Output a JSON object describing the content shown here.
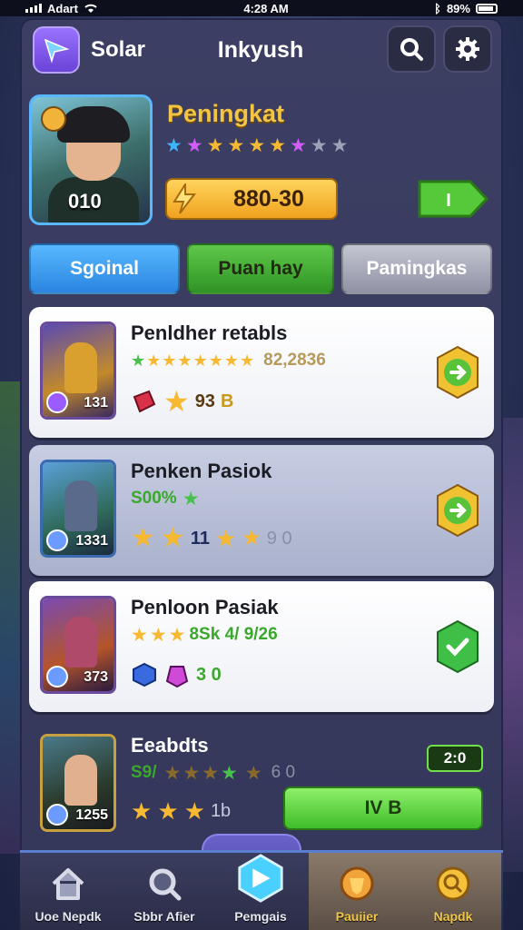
{
  "status_bar": {
    "carrier": "Adart",
    "time": "4:28 AM",
    "battery": "89%"
  },
  "top_nav": {
    "app_name": "Solar",
    "title": "Inkyush",
    "icons": [
      "send-icon",
      "search-icon",
      "gear-icon"
    ]
  },
  "profile": {
    "name": "Peningkat",
    "level": "010",
    "stars": [
      {
        "color": "#3fb4ff"
      },
      {
        "color": "#d45cff"
      },
      {
        "color": "#f6b931"
      },
      {
        "color": "#f6b931"
      },
      {
        "color": "#f6b931"
      },
      {
        "color": "#f6b931"
      },
      {
        "color": "#d45cff"
      },
      {
        "color": "#9ea2b8"
      },
      {
        "color": "#9ea2b8"
      }
    ],
    "currency": "880-30",
    "go_label": "I"
  },
  "tabs": [
    {
      "label": "Sgoinal"
    },
    {
      "label": "Puan hay"
    },
    {
      "label": "Pamingkas"
    }
  ],
  "cards": [
    {
      "title": "Penldher retabls",
      "line2_stars": [
        "#46c24a",
        "#f6b931",
        "#f6b931",
        "#f6b931",
        "#f6b931",
        "#f6b931",
        "#f6b931",
        "#f6b931"
      ],
      "line2_value": "82,2836",
      "line2_color": "#b69a5a",
      "line3": {
        "count_a": "93",
        "count_b": "B"
      },
      "thumb_level": "131",
      "action": "next"
    },
    {
      "title": "Penken Pasiok",
      "line2_value": "S00%",
      "line2_color": "#3aa82a",
      "line3": {
        "mid": "11",
        "tail": "9 0"
      },
      "thumb_level": "1331",
      "action": "next"
    },
    {
      "title": "Penloon Pasiak",
      "line2_value": "8Sk 4/ 9/26",
      "line2_color": "#3aa82a",
      "line3": {
        "count": "3 0"
      },
      "thumb_level": "373",
      "action": "done"
    },
    {
      "title": "Eeabdts",
      "line2_value": "S9/",
      "line2_color": "#3aa82a",
      "line2_tail": "6 0",
      "line3": {
        "count": "1b"
      },
      "thumb_level": "1255",
      "level_chip": "2:0",
      "claim_label": "IV B"
    }
  ],
  "bottom_nav": [
    {
      "label": "Uoe Nepdk",
      "icon": "home-icon"
    },
    {
      "label": "Sbbr Afier",
      "icon": "magnifier-icon"
    },
    {
      "label": "Pemgais",
      "icon": "crystal-icon",
      "active": true
    },
    {
      "label": "Pauiier",
      "icon": "shield-icon"
    },
    {
      "label": "Napdk",
      "icon": "coin-icon"
    }
  ]
}
